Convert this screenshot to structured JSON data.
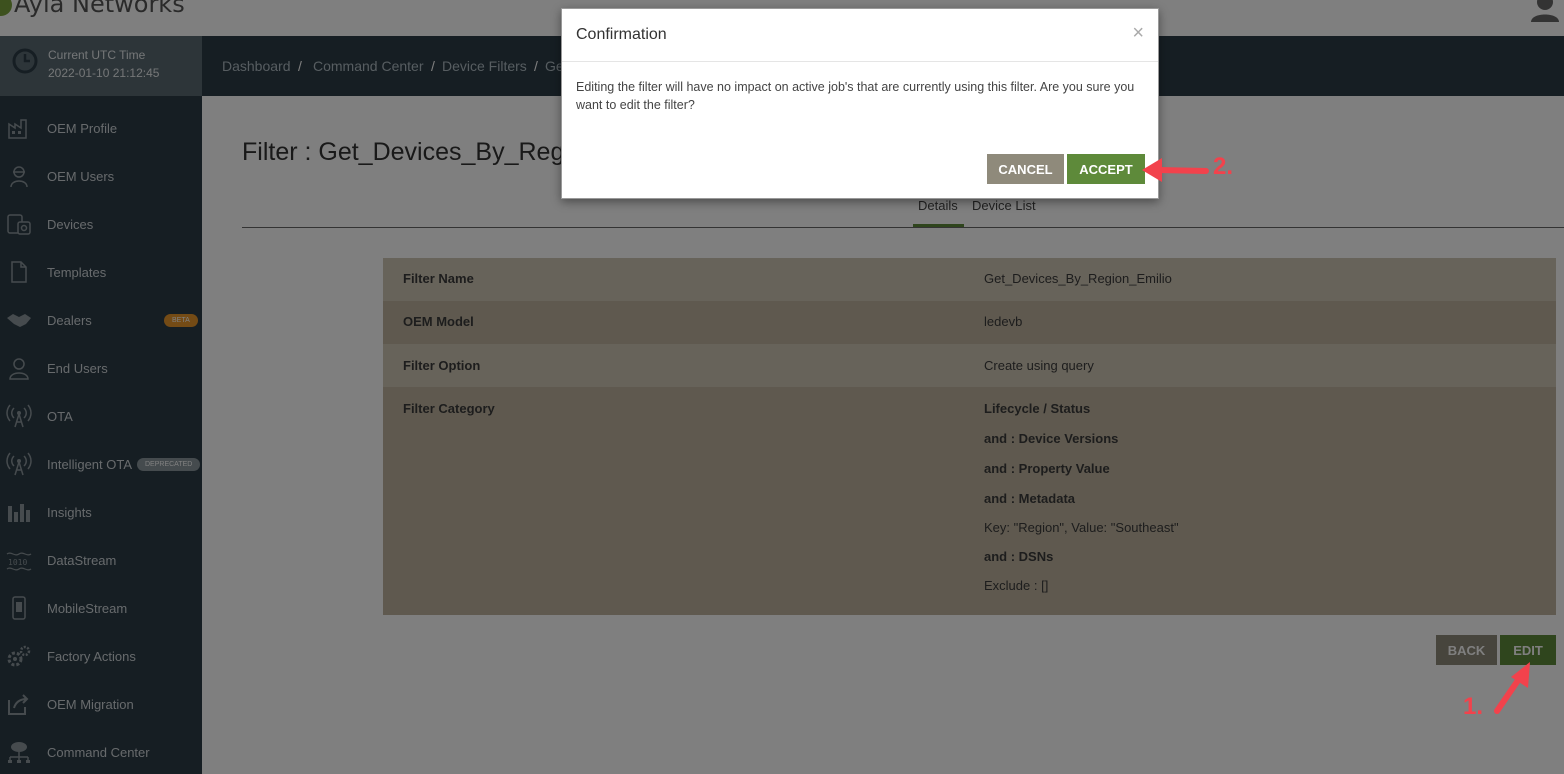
{
  "header": {
    "brand": "Ayla Networks"
  },
  "clock": {
    "title": "Current UTC Time",
    "time": "2022-01-10 21:12:45"
  },
  "sidebar": {
    "items": [
      {
        "label": "OEM Profile",
        "icon": "factory-icon"
      },
      {
        "label": "OEM Users",
        "icon": "worker-icon"
      },
      {
        "label": "Devices",
        "icon": "devices-icon"
      },
      {
        "label": "Templates",
        "icon": "document-icon"
      },
      {
        "label": "Dealers",
        "icon": "handshake-icon",
        "badge": "BETA"
      },
      {
        "label": "End Users",
        "icon": "user-icon"
      },
      {
        "label": "OTA",
        "icon": "antenna-icon"
      },
      {
        "label": "Intelligent OTA",
        "icon": "antenna-icon",
        "badge": "DEPRECATED"
      },
      {
        "label": "Insights",
        "icon": "bar-chart-icon"
      },
      {
        "label": "DataStream",
        "icon": "binary-stream-icon"
      },
      {
        "label": "MobileStream",
        "icon": "mobile-icon"
      },
      {
        "label": "Factory Actions",
        "icon": "gears-icon"
      },
      {
        "label": "OEM Migration",
        "icon": "export-icon"
      },
      {
        "label": "Command Center",
        "icon": "network-icon"
      }
    ]
  },
  "breadcrumb": [
    "Dashboard",
    "Command Center",
    "Device Filters",
    "Ge"
  ],
  "page": {
    "title": "Filter : Get_Devices_By_Regio",
    "tabs": [
      "Details",
      "Device List"
    ]
  },
  "details": {
    "filter_name_label": "Filter Name",
    "filter_name_value": "Get_Devices_By_Region_Emilio",
    "oem_model_label": "OEM Model",
    "oem_model_value": "ledevb",
    "filter_option_label": "Filter Option",
    "filter_option_value": "Create using query",
    "filter_category_label": "Filter Category",
    "category_lines": [
      {
        "text": "Lifecycle / Status",
        "bold": true
      },
      {
        "text": "and : Device Versions",
        "bold": true
      },
      {
        "text": "and : Property Value",
        "bold": true
      },
      {
        "text": "and : Metadata",
        "bold": true
      },
      {
        "text": "Key: \"Region\",  Value: \"Southeast\"",
        "bold": false
      },
      {
        "text": "and : DSNs",
        "bold": true
      },
      {
        "text": "Exclude : []",
        "bold": false
      }
    ]
  },
  "actions": {
    "back": "BACK",
    "edit": "EDIT"
  },
  "modal": {
    "title": "Confirmation",
    "close": "×",
    "body": "Editing the filter will have no impact on active job's that are currently using this filter. Are you sure you want to edit the filter?",
    "cancel": "CANCEL",
    "accept": "ACCEPT"
  },
  "annotations": {
    "step1": "1.",
    "step2": "2.",
    "color": "#f2424c"
  },
  "colors": {
    "sidebar": "#2d3d47",
    "accent_green": "#5e8a3a",
    "neutral_button": "#8f8a7b",
    "row_light": "#cfc6b4",
    "row_dark": "#beb39e"
  }
}
